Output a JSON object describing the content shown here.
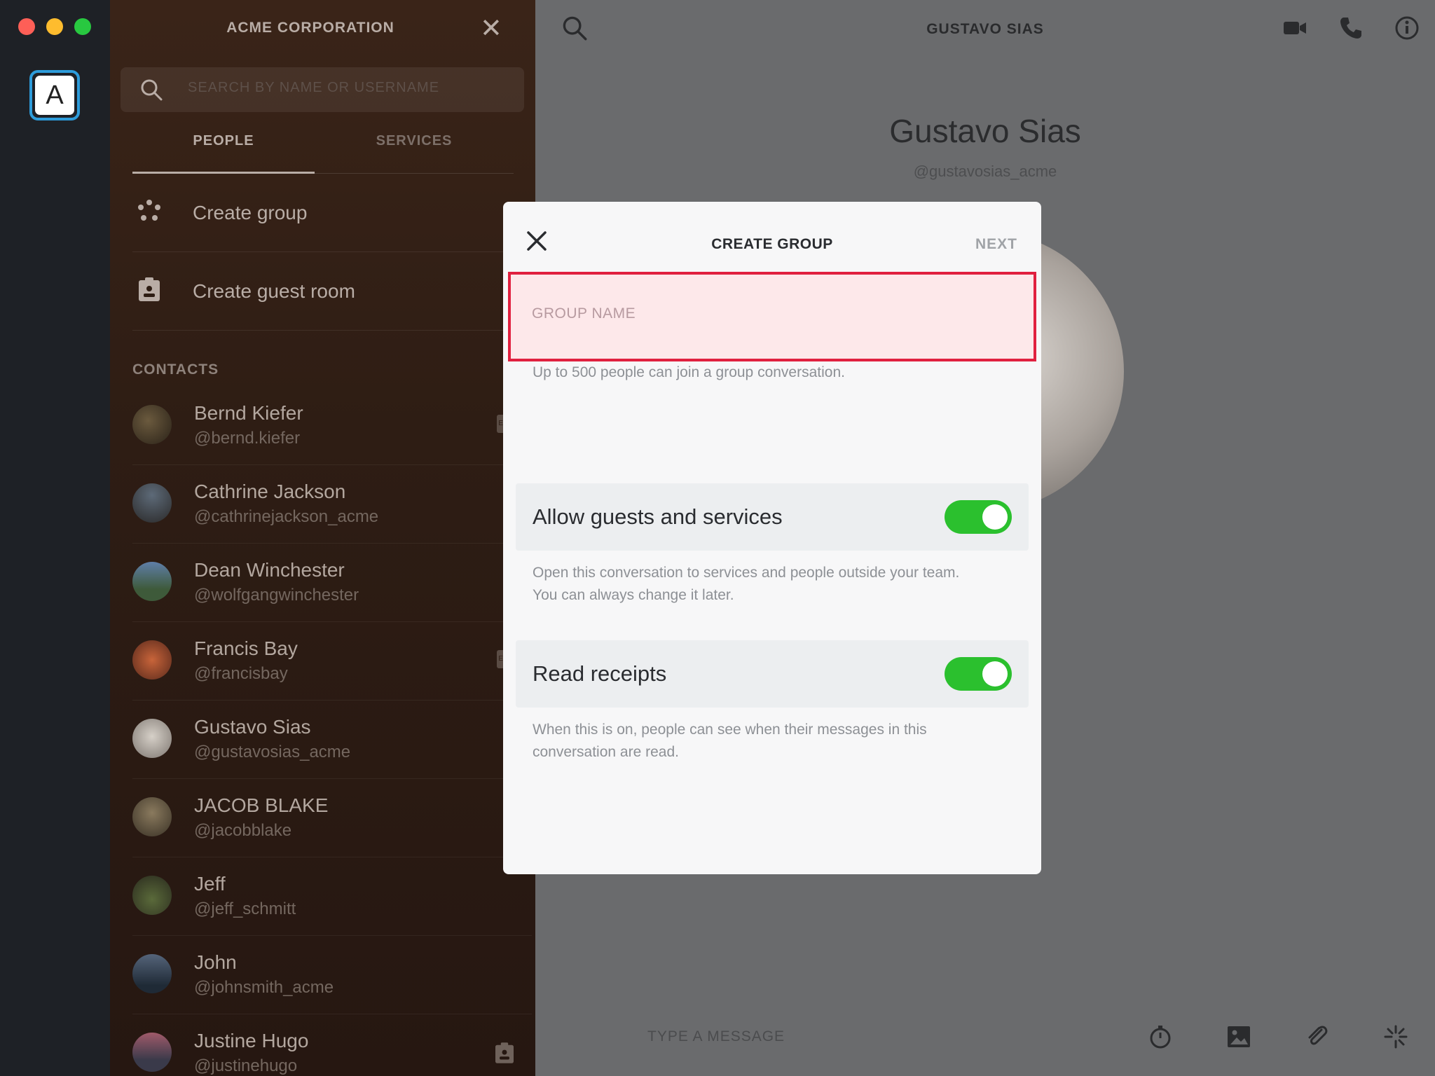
{
  "window": {
    "traffic_lights": [
      "close",
      "minimize",
      "zoom"
    ]
  },
  "rail": {
    "team_initial": "A"
  },
  "sidebar": {
    "title": "ACME CORPORATION",
    "search_placeholder": "SEARCH BY NAME OR USERNAME",
    "tabs": [
      {
        "label": "PEOPLE",
        "active": true
      },
      {
        "label": "SERVICES",
        "active": false
      }
    ],
    "actions": [
      {
        "label": "Create group",
        "icon": "group-icon"
      },
      {
        "label": "Create guest room",
        "icon": "guest-room-icon"
      }
    ],
    "contacts_label": "CONTACTS",
    "contacts": [
      {
        "name": "Bernd Kiefer",
        "handle": "@bernd.kiefer",
        "badge": "EX"
      },
      {
        "name": "Cathrine Jackson",
        "handle": "@cathrinejackson_acme",
        "badge": ""
      },
      {
        "name": "Dean Winchester",
        "handle": "@wolfgangwinchester",
        "badge": ""
      },
      {
        "name": "Francis Bay",
        "handle": "@francisbay",
        "badge": "EX"
      },
      {
        "name": "Gustavo Sias",
        "handle": "@gustavosias_acme",
        "badge": ""
      },
      {
        "name": "JACOB BLAKE",
        "handle": "@jacobblake",
        "badge": ""
      },
      {
        "name": "Jeff",
        "handle": "@jeff_schmitt",
        "badge": ""
      },
      {
        "name": "John",
        "handle": "@johnsmith_acme",
        "badge": ""
      },
      {
        "name": "Justine Hugo",
        "handle": "@justinehugo",
        "badge": ""
      }
    ]
  },
  "main": {
    "header_title": "GUSTAVO SIAS",
    "profile_name": "Gustavo Sias",
    "profile_handle": "@gustavosias_acme",
    "composer_placeholder": "TYPE A MESSAGE"
  },
  "modal": {
    "title": "CREATE GROUP",
    "next_label": "NEXT",
    "group_name_placeholder": "GROUP NAME",
    "group_name_value": "",
    "group_hint": "Up to 500 people can join a group conversation.",
    "settings": [
      {
        "label": "Allow guests and services",
        "enabled": true,
        "description_line1": "Open this conversation to services and people outside your team.",
        "description_line2": "You can always change it later."
      },
      {
        "label": "Read receipts",
        "enabled": true,
        "description_line1": "When this is on, people can see when their messages in this",
        "description_line2": "conversation are read."
      }
    ]
  },
  "colors": {
    "toggle_on": "#2bc02e",
    "highlight_border": "#e0203f",
    "team_accent": "#2d9cdb"
  }
}
